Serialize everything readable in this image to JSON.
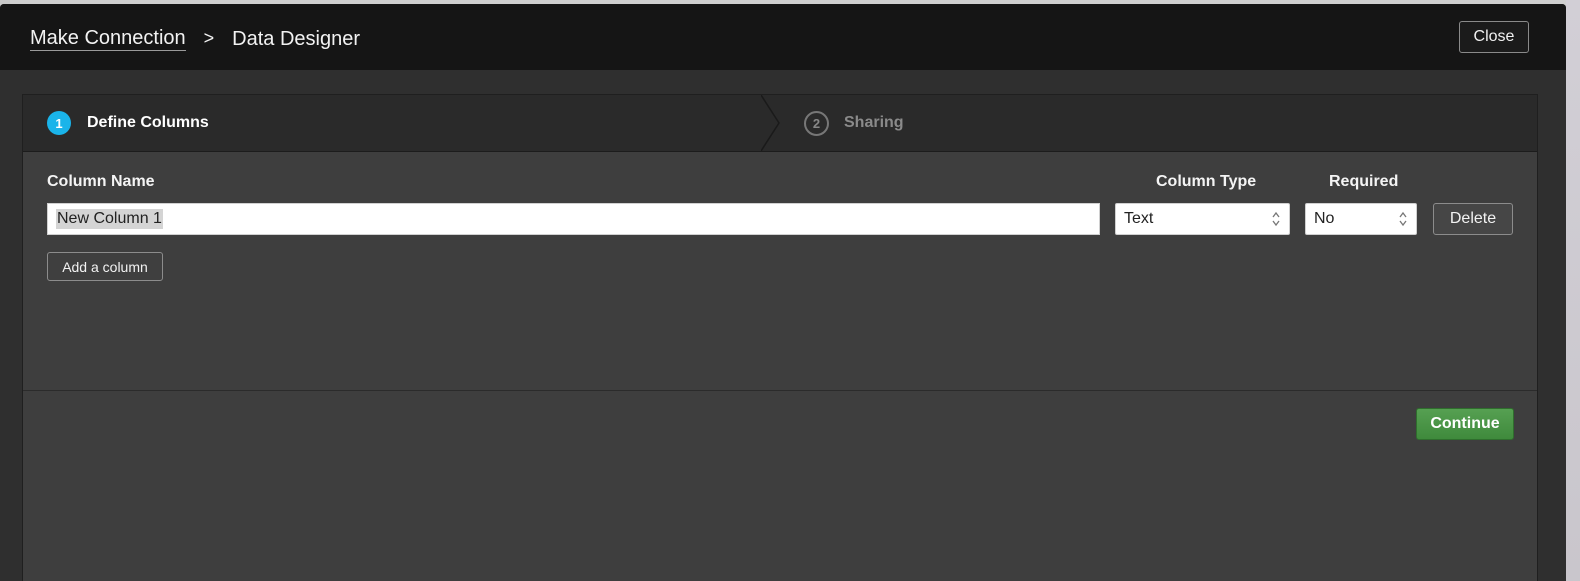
{
  "header": {
    "breadcrumb_parent": "Make Connection",
    "breadcrumb_separator": ">",
    "breadcrumb_current": "Data Designer",
    "close_label": "Close"
  },
  "steps": [
    {
      "number": "1",
      "label": "Define Columns",
      "state": "active"
    },
    {
      "number": "2",
      "label": "Sharing",
      "state": "inactive"
    }
  ],
  "columns_form": {
    "headers": {
      "name": "Column Name",
      "type": "Column Type",
      "required": "Required"
    },
    "rows": [
      {
        "name_value": "New Column 1",
        "type_value": "Text",
        "required_value": "No",
        "delete_label": "Delete"
      }
    ],
    "add_column_label": "Add a column"
  },
  "footer": {
    "continue_label": "Continue"
  },
  "colors": {
    "accent": "#1ab4ea",
    "continue_green": "#4a954a",
    "header_bg": "#151515",
    "panel_bg": "#3e3e3e"
  },
  "icons": {
    "select_arrows": "updown-chevron-icon",
    "step_divider": "chevron-right-icon"
  }
}
